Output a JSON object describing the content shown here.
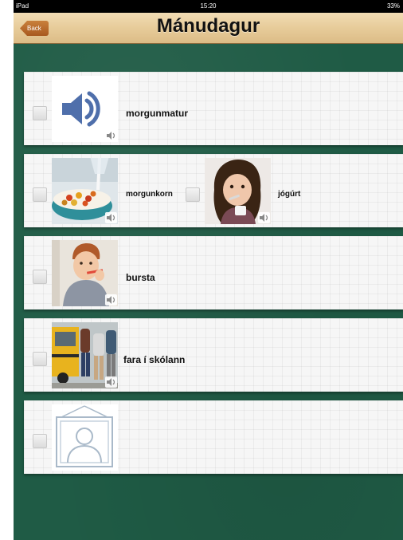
{
  "status_bar": {
    "device": "iPad",
    "time": "15:20",
    "battery": "33%"
  },
  "nav": {
    "back_label": "Back",
    "title": "Mánudagur"
  },
  "rows": [
    {
      "items": [
        {
          "label": "morgunmatur",
          "icon": "speaker-icon"
        }
      ]
    },
    {
      "items": [
        {
          "label": "morgunkorn",
          "icon": "cereal-photo"
        },
        {
          "label": "jógúrt",
          "icon": "girl-eating-yogurt-photo"
        }
      ]
    },
    {
      "items": [
        {
          "label": "bursta",
          "icon": "boy-brushing-teeth-photo"
        }
      ]
    },
    {
      "items": [
        {
          "label": "fara í skólann",
          "icon": "school-bus-photo"
        }
      ]
    },
    {
      "items": [
        {
          "label": "",
          "icon": "empty-portrait-frame-icon"
        }
      ]
    }
  ],
  "colors": {
    "board": "#1f5b45",
    "nav": "#e8cd9c",
    "back": "#b8692b",
    "speaker": "#4f6fab"
  }
}
